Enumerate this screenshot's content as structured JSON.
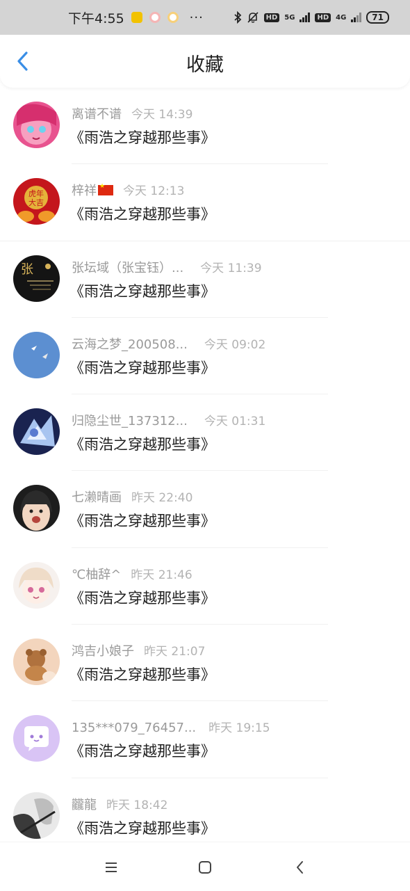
{
  "status_bar": {
    "time": "下午4:55",
    "dots": "···",
    "hd1": "HD",
    "net1": "5G",
    "hd2": "HD",
    "net2": "4G",
    "battery": "71"
  },
  "header": {
    "title": "收藏"
  },
  "list": [
    {
      "name": "离谱不谱",
      "time": "今天 14:39",
      "title": "《雨浩之穿越那些事》"
    },
    {
      "name": "梓祥",
      "time": "今天 12:13",
      "title": "《雨浩之穿越那些事》"
    },
    {
      "name": "张坛域（张宝钰）...",
      "time": "今天 11:39",
      "title": "《雨浩之穿越那些事》"
    },
    {
      "name": "云海之梦_200508...",
      "time": "今天 09:02",
      "title": "《雨浩之穿越那些事》"
    },
    {
      "name": "归隐尘世_137312...",
      "time": "今天 01:31",
      "title": "《雨浩之穿越那些事》"
    },
    {
      "name": "七濑晴画",
      "time": "昨天 22:40",
      "title": "《雨浩之穿越那些事》"
    },
    {
      "name": "℃柚辞^",
      "time": "昨天 21:46",
      "title": "《雨浩之穿越那些事》"
    },
    {
      "name": "鸿吉小娘子",
      "time": "昨天 21:07",
      "title": "《雨浩之穿越那些事》"
    },
    {
      "name": "135***079_76457...",
      "time": "昨天 19:15",
      "title": "《雨浩之穿越那些事》"
    },
    {
      "name": "龖龍",
      "time": "昨天 18:42",
      "title": "《雨浩之穿越那些事》"
    }
  ],
  "avatars": {
    "2": {
      "line1": "虎年",
      "line2": "大吉"
    },
    "3": {
      "char": "张"
    }
  },
  "colors": {
    "accent": "#3a8ee6",
    "title_text": "#1f1f1f",
    "meta_text": "#9a9a9a"
  }
}
